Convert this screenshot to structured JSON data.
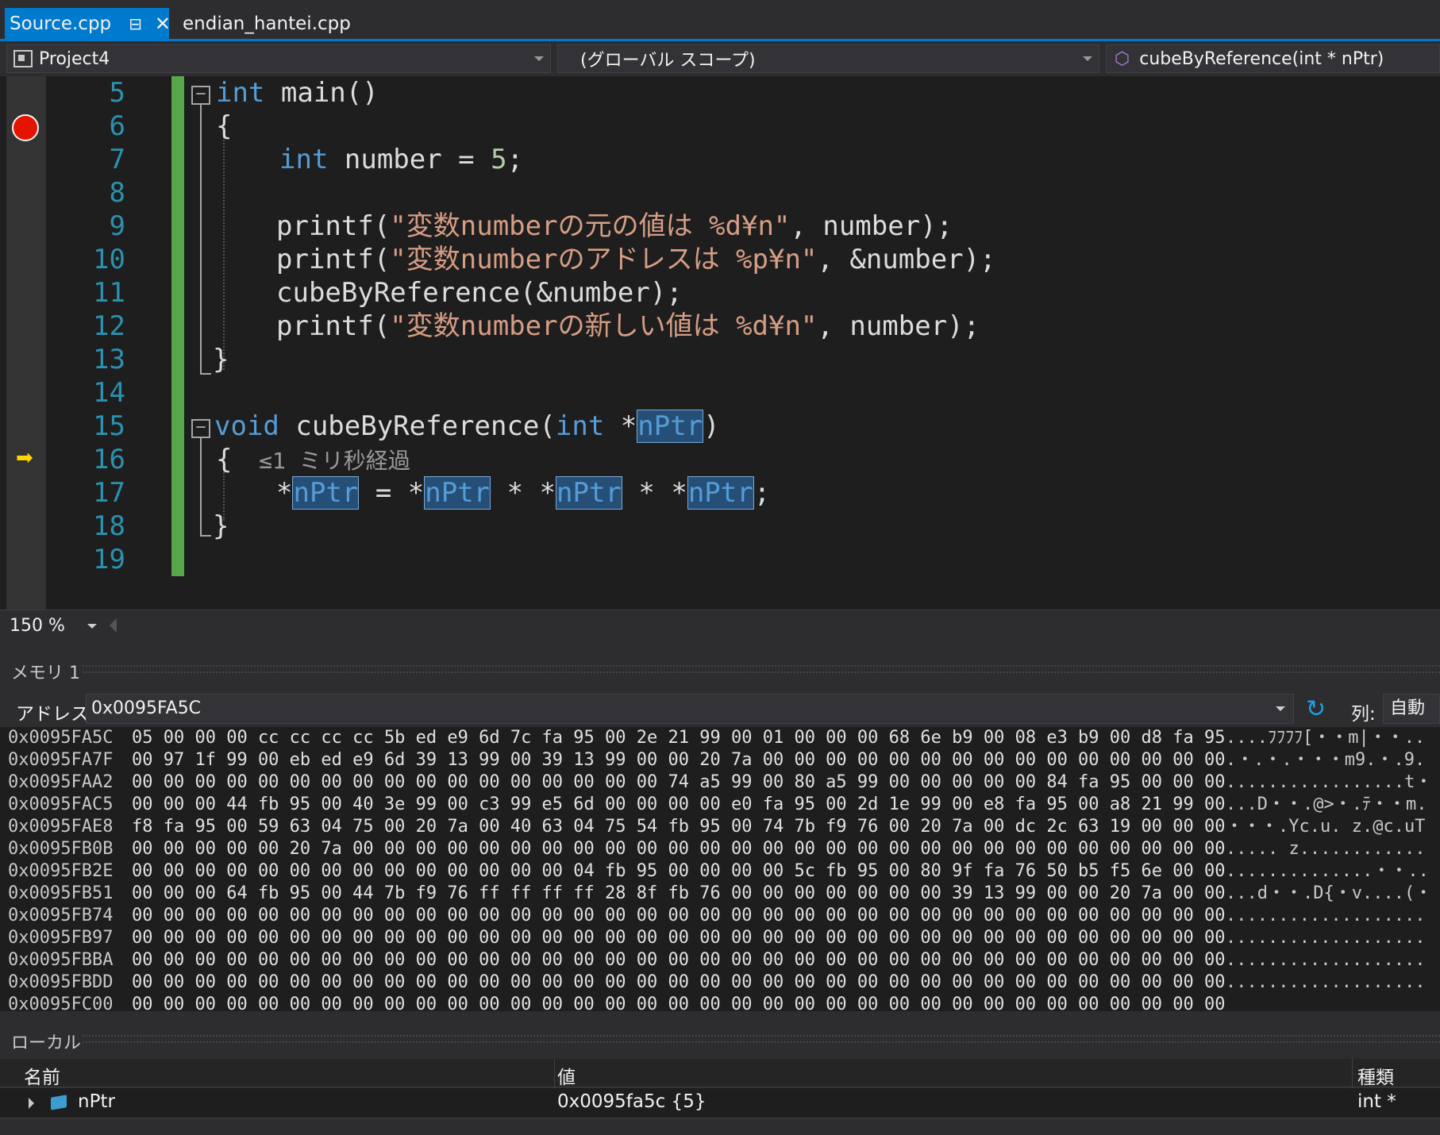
{
  "tabs": {
    "active": {
      "label": "Source.cpp",
      "pin_glyph": "⊟",
      "close_glyph": "✕"
    },
    "inactive": {
      "label": "endian_hantei.cpp"
    }
  },
  "navbar": {
    "project": "Project4",
    "scope": "(グローバル スコープ)",
    "member": "cubeByReference(int * nPtr)"
  },
  "editor": {
    "line_numbers": [
      "5",
      "6",
      "7",
      "8",
      "9",
      "10",
      "11",
      "12",
      "13",
      "14",
      "15",
      "16",
      "17",
      "18",
      "19"
    ],
    "breakpoint_line": "6",
    "current_line": "16",
    "hint": "≤1 ミリ秒経過",
    "code": {
      "l5_kw": "int",
      "l5_rest": " main()",
      "l6": "{",
      "l7_kw": "int",
      "l7_mid": " number = ",
      "l7_num": "5",
      "l7_end": ";",
      "l9_a": "printf(",
      "l9_str": "\"変数numberの元の値は %d¥n\"",
      "l9_b": ", number);",
      "l10_a": "printf(",
      "l10_str": "\"変数numberのアドレスは %p¥n\"",
      "l10_b": ", &number);",
      "l11": "cubeByReference(&number);",
      "l12_a": "printf(",
      "l12_str": "\"変数numberの新しい値は %d¥n\"",
      "l12_b": ", number);",
      "l13": "}",
      "l15_kw": "void",
      "l15_mid": " cubeByReference(",
      "l15_kw2": "int",
      "l15_star": " *",
      "l15_param": "nPtr",
      "l15_end": ")",
      "l16": "{",
      "l17_star": "*",
      "l17_p": "nPtr",
      "l17_op1": " = *",
      "l17_op2": " * *",
      "l17_op3": " * *",
      "l17_end": ";",
      "l18": "}"
    }
  },
  "zoom": {
    "value": "150 %"
  },
  "memory": {
    "title": "メモリ 1",
    "address_label": "アドレス:",
    "address_value": "0x0095FA5C",
    "column_label": "列:",
    "column_value": "自動",
    "rows": [
      {
        "addr": "0x0095FA5C",
        "hex": "05 00 00 00 cc cc cc cc 5b ed e9 6d 7c fa 95 00 2e 21 99 00 01 00 00 00 68 6e b9 00 08 e3 b9 00 d8 fa 95",
        "ascii": "....ﾌﾌﾌﾌ[・・m|・・.."
      },
      {
        "addr": "0x0095FA7F",
        "hex": "00 97 1f 99 00 eb ed e9 6d 39 13 99 00 39 13 99 00 00 20 7a 00 00 00 00 00 00 00 00 00 00 00 00 00 00 00",
        "ascii": ".・.・.・・・m9.・.9."
      },
      {
        "addr": "0x0095FAA2",
        "hex": "00 00 00 00 00 00 00 00 00 00 00 00 00 00 00 00 00 74 a5 99 00 80 a5 99 00 00 00 00 00 84 fa 95 00 00 00",
        "ascii": ".................t・"
      },
      {
        "addr": "0x0095FAC5",
        "hex": "00 00 00 44 fb 95 00 40 3e 99 00 c3 99 e5 6d 00 00 00 00 e0 fa 95 00 2d 1e 99 00 e8 fa 95 00 a8 21 99 00",
        "ascii": "...D・・.@>・.ﾃ・・m."
      },
      {
        "addr": "0x0095FAE8",
        "hex": "f8 fa 95 00 59 63 04 75 00 20 7a 00 40 63 04 75 54 fb 95 00 74 7b f9 76 00 20 7a 00 dc 2c 63 19 00 00 00",
        "ascii": "・・・.Yc.u. z.@c.uT"
      },
      {
        "addr": "0x0095FB0B",
        "hex": "00 00 00 00 00 20 7a 00 00 00 00 00 00 00 00 00 00 00 00 00 00 00 00 00 00 00 00 00 00 00 00 00 00 00 00",
        "ascii": "..... z............"
      },
      {
        "addr": "0x0095FB2E",
        "hex": "00 00 00 00 00 00 00 00 00 00 00 00 00 00 04 fb 95 00 00 00 00 5c fb 95 00 80 9f fa 76 50 b5 f5 6e 00 00",
        "ascii": "..............・・.."
      },
      {
        "addr": "0x0095FB51",
        "hex": "00 00 00 64 fb 95 00 44 7b f9 76 ff ff ff ff 28 8f fb 76 00 00 00 00 00 00 00 39 13 99 00 00 20 7a 00 00",
        "ascii": "...d・・.D{・v....(・"
      },
      {
        "addr": "0x0095FB74",
        "hex": "00 00 00 00 00 00 00 00 00 00 00 00 00 00 00 00 00 00 00 00 00 00 00 00 00 00 00 00 00 00 00 00 00 00 00",
        "ascii": "..................."
      },
      {
        "addr": "0x0095FB97",
        "hex": "00 00 00 00 00 00 00 00 00 00 00 00 00 00 00 00 00 00 00 00 00 00 00 00 00 00 00 00 00 00 00 00 00 00 00",
        "ascii": "..................."
      },
      {
        "addr": "0x0095FBBA",
        "hex": "00 00 00 00 00 00 00 00 00 00 00 00 00 00 00 00 00 00 00 00 00 00 00 00 00 00 00 00 00 00 00 00 00 00 00",
        "ascii": "..................."
      },
      {
        "addr": "0x0095FBDD",
        "hex": "00 00 00 00 00 00 00 00 00 00 00 00 00 00 00 00 00 00 00 00 00 00 00 00 00 00 00 00 00 00 00 00 00 00 00",
        "ascii": "..................."
      },
      {
        "addr": "0x0095FC00",
        "hex": "00 00 00 00 00 00 00 00 00 00 00 00 00 00 00 00 00 00 00 00 00 00 00 00 00 00 00 00 00 00 00 00 00 00 00",
        "ascii": ""
      }
    ]
  },
  "locals": {
    "title": "ローカル",
    "headers": {
      "name": "名前",
      "value": "値",
      "type": "種類"
    },
    "rows": [
      {
        "name": "nPtr",
        "value": "0x0095fa5c {5}",
        "type": "int *"
      }
    ]
  },
  "colors": {
    "accent": "#007acc",
    "keyword": "#569cd6",
    "string": "#d69d85",
    "line_number": "#2b91af",
    "breakpoint": "#e51400",
    "change_bar": "#57a64a"
  }
}
